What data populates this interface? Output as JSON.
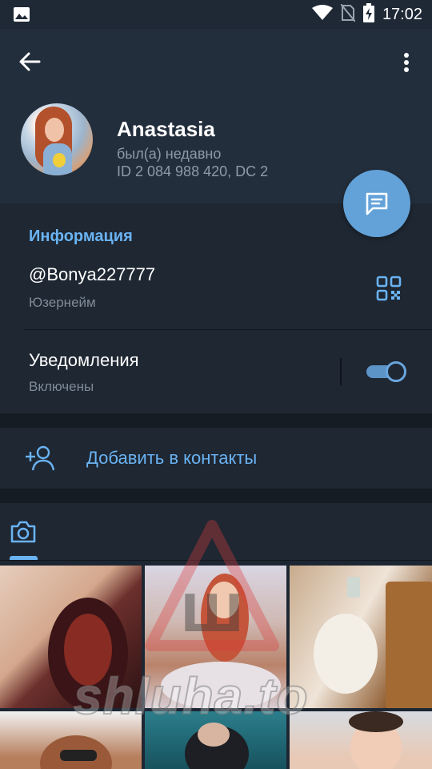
{
  "status_bar": {
    "time": "17:02",
    "icons": [
      "image-icon",
      "wifi-icon",
      "no-sim-icon",
      "battery-charging-icon"
    ]
  },
  "toolbar": {
    "back_icon": "arrow-left-icon",
    "menu_icon": "more-vertical-icon"
  },
  "profile": {
    "name": "Anastasia",
    "last_seen": "был(а) недавно",
    "id_line": "ID 2 084 988 420, DC 2",
    "message_icon": "message-icon"
  },
  "info": {
    "section_title": "Информация",
    "username": "@Bonya227777",
    "username_label": "Юзернейм",
    "qr_icon": "qr-code-icon",
    "notifications_title": "Уведомления",
    "notifications_status": "Включены",
    "notifications_enabled": true
  },
  "actions": {
    "add_contact_label": "Добавить в контакты",
    "add_contact_icon": "add-user-icon"
  },
  "media": {
    "tabs": [
      "camera-icon"
    ],
    "thumbnails": [
      "photo-1",
      "photo-2",
      "photo-3",
      "photo-4",
      "photo-5",
      "photo-6"
    ]
  },
  "watermark": {
    "text": "shluha.to",
    "logo_letter": "Ш"
  },
  "colors": {
    "background": "#1d2733",
    "header": "#232e3c",
    "accent": "#6ab3f3",
    "fab": "#63a2d8",
    "secondary_text": "#7f8b98"
  }
}
